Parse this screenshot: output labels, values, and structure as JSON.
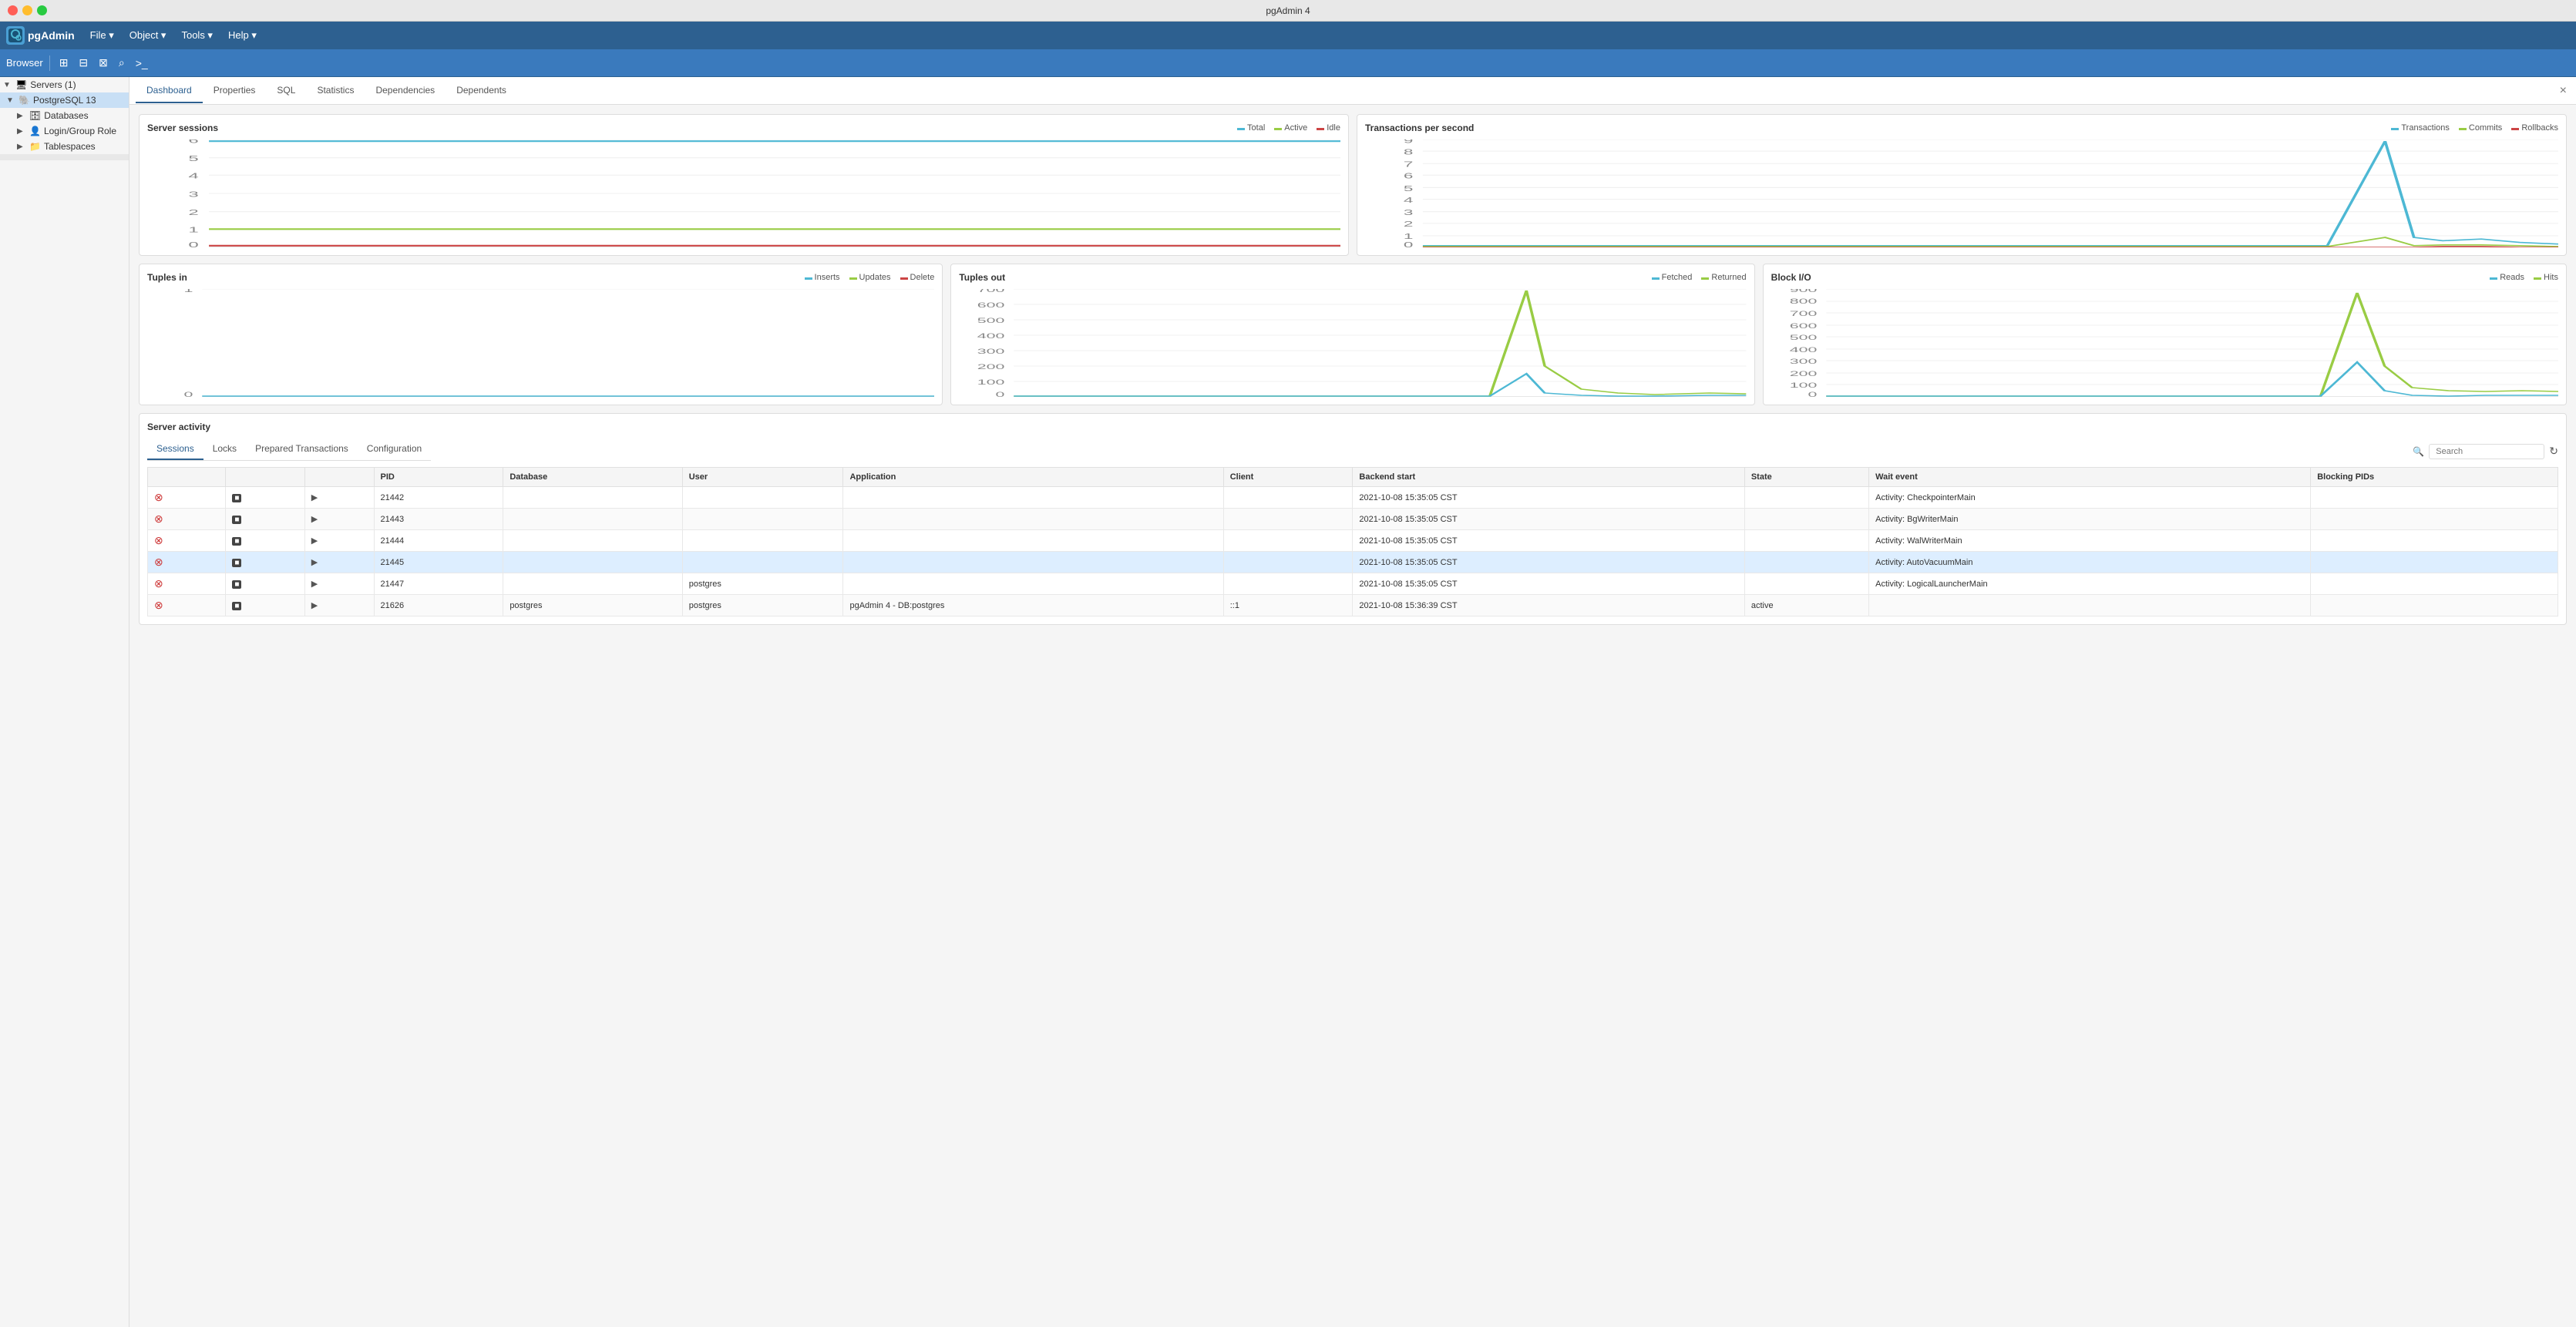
{
  "window": {
    "title": "pgAdmin 4"
  },
  "titlebar_buttons": {
    "close": "×",
    "minimize": "−",
    "maximize": "+"
  },
  "menubar": {
    "logo": "pgAdmin",
    "logo_icon": "pg",
    "items": [
      "File",
      "Object",
      "Tools",
      "Help"
    ]
  },
  "toolbar": {
    "browser_label": "Browser",
    "icons": [
      "grid-icon",
      "table-icon",
      "query-icon",
      "search-icon",
      "terminal-icon"
    ]
  },
  "sidebar": {
    "items": [
      {
        "label": "Servers (1)",
        "level": 0,
        "expanded": true,
        "type": "server-group"
      },
      {
        "label": "PostgreSQL 13",
        "level": 1,
        "expanded": true,
        "type": "server",
        "selected": true
      },
      {
        "label": "Databases",
        "level": 2,
        "expanded": false,
        "type": "database-group"
      },
      {
        "label": "Login/Group Role",
        "level": 2,
        "expanded": false,
        "type": "role-group"
      },
      {
        "label": "Tablespaces",
        "level": 2,
        "expanded": false,
        "type": "tablespace-group"
      }
    ]
  },
  "tabs": {
    "items": [
      "Dashboard",
      "Properties",
      "SQL",
      "Statistics",
      "Dependencies",
      "Dependents"
    ],
    "active": "Dashboard",
    "close_icon": "×"
  },
  "dashboard": {
    "charts": {
      "server_sessions": {
        "title": "Server sessions",
        "legend": [
          {
            "label": "Total",
            "color": "#4db8d4"
          },
          {
            "label": "Active",
            "color": "#99cc44"
          },
          {
            "label": "Idle",
            "color": "#cc4444"
          }
        ],
        "y_labels": [
          "6",
          "5",
          "4",
          "3",
          "2",
          "1",
          "0"
        ],
        "lines": {
          "total": {
            "color": "#4db8d4",
            "value": 6
          },
          "active": {
            "color": "#99cc44",
            "value": 1
          },
          "idle": {
            "color": "#cc4444",
            "value": 0
          }
        }
      },
      "transactions_per_second": {
        "title": "Transactions per second",
        "legend": [
          {
            "label": "Transactions",
            "color": "#4db8d4"
          },
          {
            "label": "Commits",
            "color": "#99cc44"
          },
          {
            "label": "Rollbacks",
            "color": "#cc4444"
          }
        ],
        "y_labels": [
          "9",
          "8",
          "7",
          "6",
          "5",
          "4",
          "3",
          "2",
          "1",
          "0"
        ],
        "peak_value": 9
      },
      "tuples_in": {
        "title": "Tuples in",
        "legend": [
          {
            "label": "Inserts",
            "color": "#4db8d4"
          },
          {
            "label": "Updates",
            "color": "#99cc44"
          },
          {
            "label": "Delete",
            "color": "#cc4444"
          }
        ],
        "y_labels": [
          "1",
          "",
          "",
          "",
          "",
          "",
          "",
          "",
          "",
          "0"
        ]
      },
      "tuples_out": {
        "title": "Tuples out",
        "legend": [
          {
            "label": "Fetched",
            "color": "#4db8d4"
          },
          {
            "label": "Returned",
            "color": "#99cc44"
          }
        ],
        "y_labels": [
          "700",
          "600",
          "500",
          "400",
          "300",
          "200",
          "100",
          "0"
        ],
        "peak_value": 700
      },
      "block_io": {
        "title": "Block I/O",
        "legend": [
          {
            "label": "Reads",
            "color": "#4db8d4"
          },
          {
            "label": "Hits",
            "color": "#99cc44"
          }
        ],
        "y_labels": [
          "900",
          "800",
          "700",
          "600",
          "500",
          "400",
          "300",
          "200",
          "100",
          "0"
        ],
        "peak_value": 900
      }
    },
    "server_activity": {
      "title": "Server activity",
      "tabs": [
        "Sessions",
        "Locks",
        "Prepared Transactions",
        "Configuration"
      ],
      "active_tab": "Sessions",
      "search_placeholder": "Search",
      "refresh_icon": "↻",
      "table": {
        "columns": [
          "",
          "",
          "",
          "PID",
          "Database",
          "User",
          "Application",
          "Client",
          "Backend start",
          "State",
          "Wait event",
          "Blocking PIDs"
        ],
        "rows": [
          {
            "pid": "21442",
            "database": "",
            "user": "",
            "application": "",
            "client": "",
            "backend_start": "2021-10-08 15:35:05 CST",
            "state": "",
            "wait_event": "Activity: CheckpointerMain",
            "blocking_pids": "",
            "highlighted": false
          },
          {
            "pid": "21443",
            "database": "",
            "user": "",
            "application": "",
            "client": "",
            "backend_start": "2021-10-08 15:35:05 CST",
            "state": "",
            "wait_event": "Activity: BgWriterMain",
            "blocking_pids": "",
            "highlighted": false
          },
          {
            "pid": "21444",
            "database": "",
            "user": "",
            "application": "",
            "client": "",
            "backend_start": "2021-10-08 15:35:05 CST",
            "state": "",
            "wait_event": "Activity: WalWriterMain",
            "blocking_pids": "",
            "highlighted": false
          },
          {
            "pid": "21445",
            "database": "",
            "user": "",
            "application": "",
            "client": "",
            "backend_start": "2021-10-08 15:35:05 CST",
            "state": "",
            "wait_event": "Activity: AutoVacuumMain",
            "blocking_pids": "",
            "highlighted": true
          },
          {
            "pid": "21447",
            "database": "",
            "user": "postgres",
            "application": "",
            "client": "",
            "backend_start": "2021-10-08 15:35:05 CST",
            "state": "",
            "wait_event": "Activity: LogicalLauncherMain",
            "blocking_pids": "",
            "highlighted": false
          },
          {
            "pid": "21626",
            "database": "postgres",
            "user": "postgres",
            "application": "pgAdmin 4 - DB:postgres",
            "client": "::1",
            "backend_start": "2021-10-08 15:36:39 CST",
            "state": "active",
            "wait_event": "",
            "blocking_pids": "",
            "highlighted": false
          }
        ]
      }
    }
  }
}
